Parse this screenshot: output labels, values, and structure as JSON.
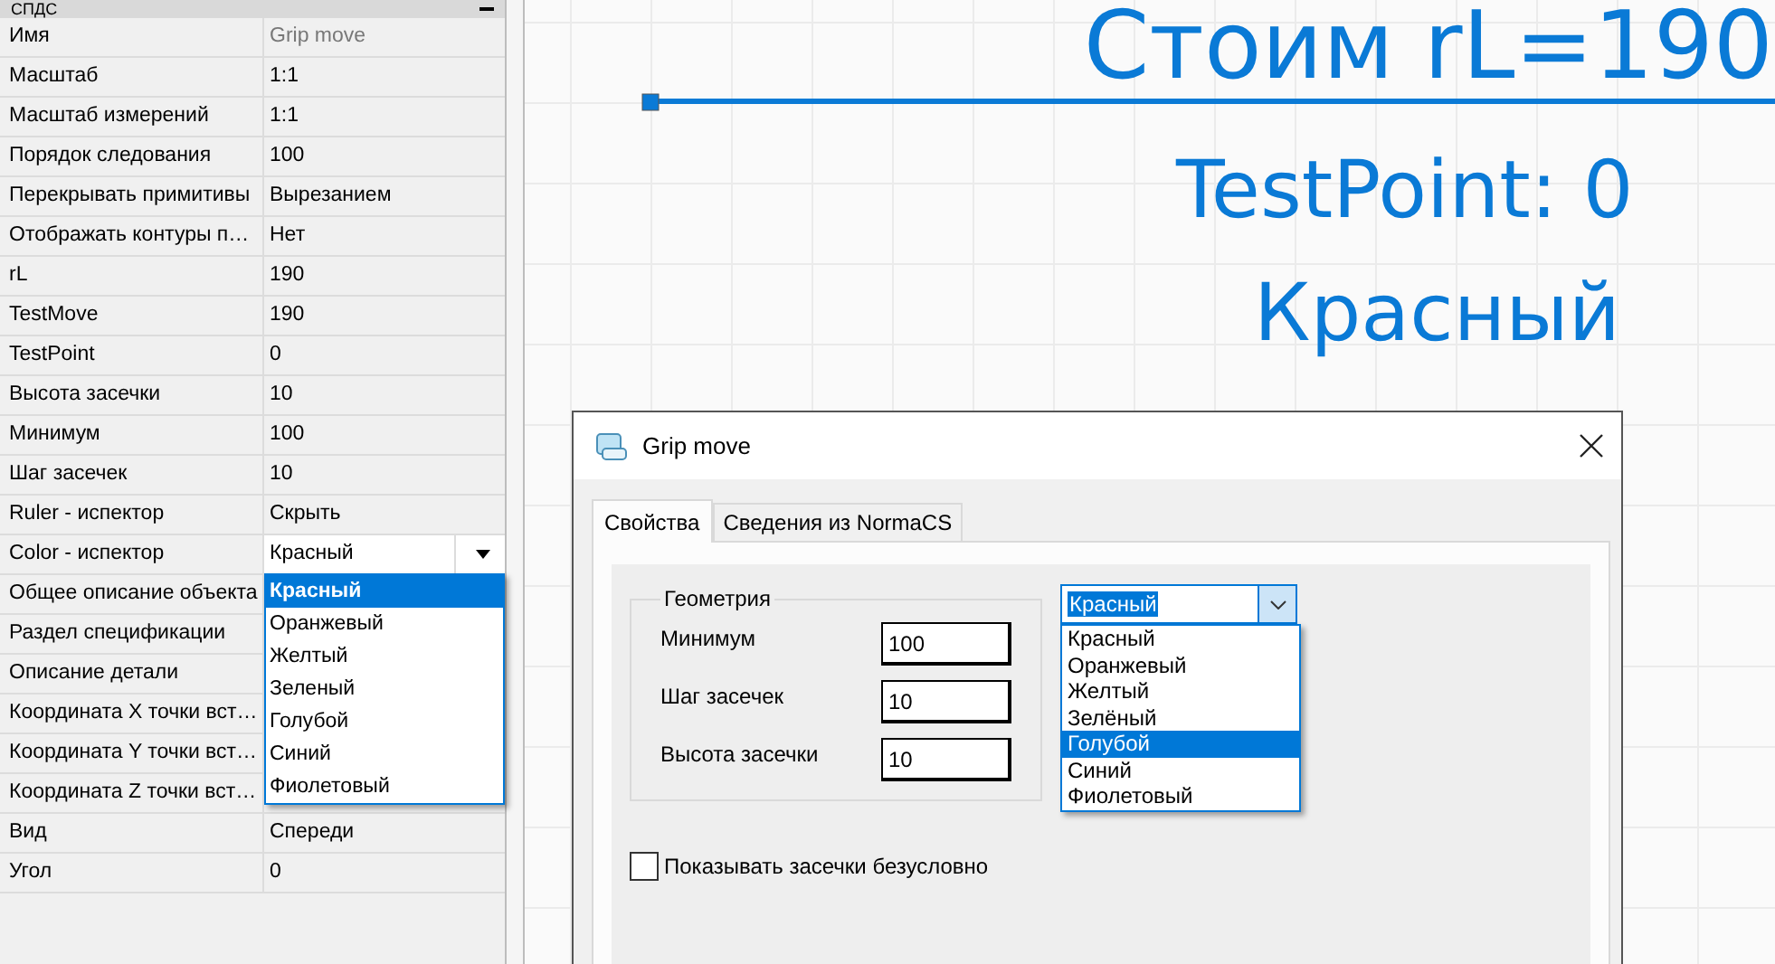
{
  "panel": {
    "title": "СПДС",
    "properties": [
      {
        "name": "Имя",
        "value": "Grip move",
        "kind": "readonly"
      },
      {
        "name": "Масштаб",
        "value": "1:1",
        "kind": "text"
      },
      {
        "name": "Масштаб измерений",
        "value": "1:1",
        "kind": "text"
      },
      {
        "name": "Порядок следования",
        "value": "100",
        "kind": "text"
      },
      {
        "name": "Перекрывать примитивы",
        "value": "Вырезанием",
        "kind": "text"
      },
      {
        "name": "Отображать контуры п…",
        "value": "Нет",
        "kind": "text"
      },
      {
        "name": "rL",
        "value": "190",
        "kind": "text"
      },
      {
        "name": "TestMove",
        "value": "190",
        "kind": "text"
      },
      {
        "name": "TestPoint",
        "value": "0",
        "kind": "text"
      },
      {
        "name": "Высота засечки",
        "value": "10",
        "kind": "text"
      },
      {
        "name": "Минимум",
        "value": "100",
        "kind": "text"
      },
      {
        "name": "Шаг засечек",
        "value": "10",
        "kind": "text"
      },
      {
        "name": "Ruler - испектор",
        "value": "Скрыть",
        "kind": "text"
      },
      {
        "name": "Color - испектор",
        "value": "Красный",
        "kind": "dropdown"
      },
      {
        "name": "Общее описание объекта",
        "kind": "text"
      },
      {
        "name": "Раздел спецификации",
        "kind": "text"
      },
      {
        "name": "Описание детали",
        "kind": "text"
      },
      {
        "name": "Координата X точки вст…",
        "kind": "text"
      },
      {
        "name": "Координата Y точки вст…",
        "kind": "text"
      },
      {
        "name": "Координата Z точки вст…",
        "kind": "text"
      },
      {
        "name": "Вид",
        "value": "Спереди",
        "kind": "text"
      },
      {
        "name": "Угол",
        "value": "0",
        "kind": "text"
      }
    ],
    "color_dropdown": {
      "options": [
        {
          "label": "Красный",
          "selected": true
        },
        {
          "label": "Оранжевый",
          "selected": false
        },
        {
          "label": "Желтый",
          "selected": false
        },
        {
          "label": "Зеленый",
          "selected": false
        },
        {
          "label": "Голубой",
          "selected": false
        },
        {
          "label": "Синий",
          "selected": false
        },
        {
          "label": "Фиолетовый",
          "selected": false
        }
      ]
    }
  },
  "canvas": {
    "title": "Стоим rL=190",
    "lines": [
      "TestPoint: 0",
      "Красный"
    ]
  },
  "dialog": {
    "title": "Grip move",
    "tabs": [
      {
        "label": "Свойства",
        "selected": true
      },
      {
        "label": "Сведения из NormaCS",
        "selected": false
      }
    ],
    "group": {
      "title": "Геометрия",
      "fields": [
        {
          "label": "Минимум",
          "value": "100"
        },
        {
          "label": "Шаг засечек",
          "value": "10"
        },
        {
          "label": "Высота засечки",
          "value": "10"
        }
      ]
    },
    "color_combo": {
      "value": "Красный",
      "options": [
        {
          "label": "Красный",
          "highlighted": false
        },
        {
          "label": "Оранжевый",
          "highlighted": false
        },
        {
          "label": "Желтый",
          "highlighted": false
        },
        {
          "label": "Зелёный",
          "highlighted": false
        },
        {
          "label": "Голубой",
          "highlighted": true
        },
        {
          "label": "Синий",
          "highlighted": false
        },
        {
          "label": "Фиолетовый",
          "highlighted": false
        }
      ]
    },
    "checkbox": {
      "label": "Показывать засечки безусловно",
      "checked": false
    }
  }
}
